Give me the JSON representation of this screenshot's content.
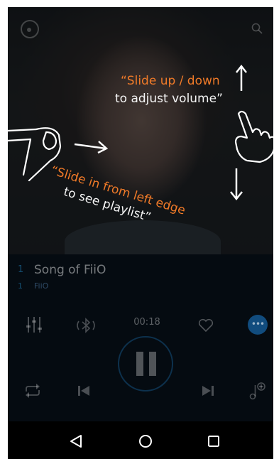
{
  "overlay": {
    "volume_line1": "“Slide up / down",
    "volume_line2": "to adjust volume”",
    "playlist_line1": "“Slide in from left edge",
    "playlist_line2": "to see playlist”"
  },
  "track": {
    "index": "1",
    "index2": "1",
    "title": "Song of FiiO",
    "artist": "FiiO"
  },
  "player": {
    "time": "00:18"
  },
  "colors": {
    "accent_orange": "#f07a28",
    "accent_blue": "#1e78c8",
    "nav_background": "#000000"
  },
  "icons": {
    "top_left": "fiio-logo-icon",
    "top_right": "search-icon",
    "equalizer": "equalizer-icon",
    "bluetooth": "bluetooth-icon",
    "favorite": "heart-icon",
    "more": "more-icon",
    "play_pause": "pause-icon",
    "repeat": "repeat-icon",
    "previous": "previous-icon",
    "next": "next-icon",
    "add_music": "add-music-icon",
    "nav_back": "back-triangle-icon",
    "nav_home": "home-circle-icon",
    "nav_recent": "recent-square-icon"
  }
}
